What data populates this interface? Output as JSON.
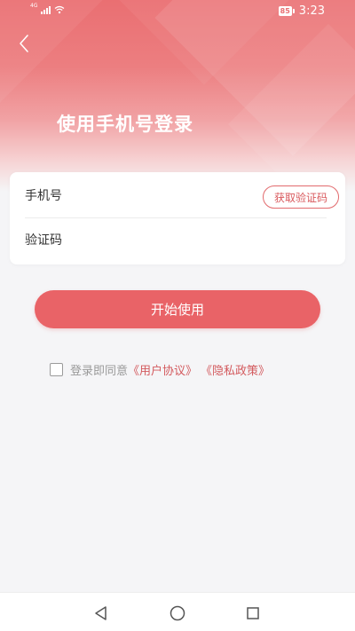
{
  "status_bar": {
    "network_type": "4G",
    "battery": "85",
    "time": "3:23"
  },
  "header": {
    "title": "使用手机号登录"
  },
  "form": {
    "phone_placeholder": "手机号",
    "code_placeholder": "验证码",
    "get_code_label": "获取验证码"
  },
  "start_button_label": "开始使用",
  "agreement": {
    "prefix": "登录即同意",
    "user_agreement": "《用户协议》",
    "privacy_policy": "《隐私政策》",
    "checked": false
  },
  "colors": {
    "accent": "#e96367",
    "link": "#d35a5e"
  },
  "icons": [
    "back-arrow-icon",
    "signal-icon",
    "wifi-icon",
    "battery-icon",
    "nav-back-icon",
    "nav-home-icon",
    "nav-recent-icon",
    "checkbox-icon"
  ]
}
